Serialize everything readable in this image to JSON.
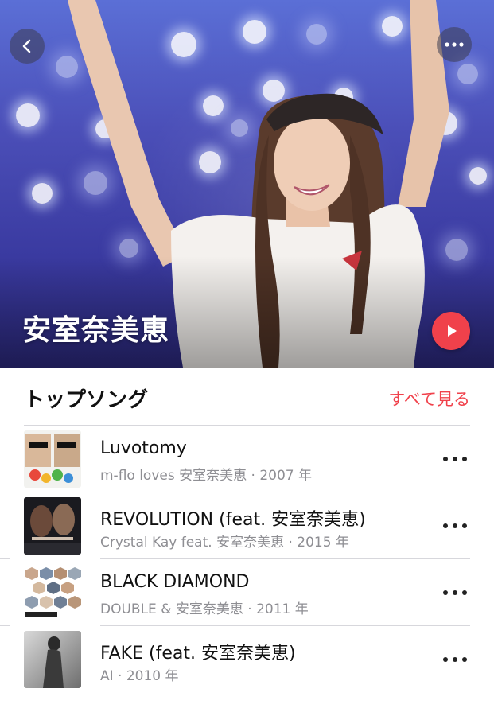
{
  "hero": {
    "artist_name": "安室奈美恵",
    "back_icon": "chevron-left-icon",
    "more_icon": "ellipsis-icon",
    "play_icon": "play-icon",
    "accent_color": "#f0414b"
  },
  "top_songs": {
    "title": "トップソング",
    "see_all_label": "すべて見る",
    "items": [
      {
        "title": "Luvotomy",
        "subtitle": "m-flo loves 安室奈美恵 · 2007 年"
      },
      {
        "title": "REVOLUTION (feat. 安室奈美恵)",
        "subtitle": "Crystal Kay feat. 安室奈美恵 · 2015 年"
      },
      {
        "title": "BLACK DIAMOND",
        "subtitle": "DOUBLE & 安室奈美恵 · 2011 年"
      },
      {
        "title": "FAKE (feat. 安室奈美恵)",
        "subtitle": "AI · 2010 年"
      }
    ]
  }
}
